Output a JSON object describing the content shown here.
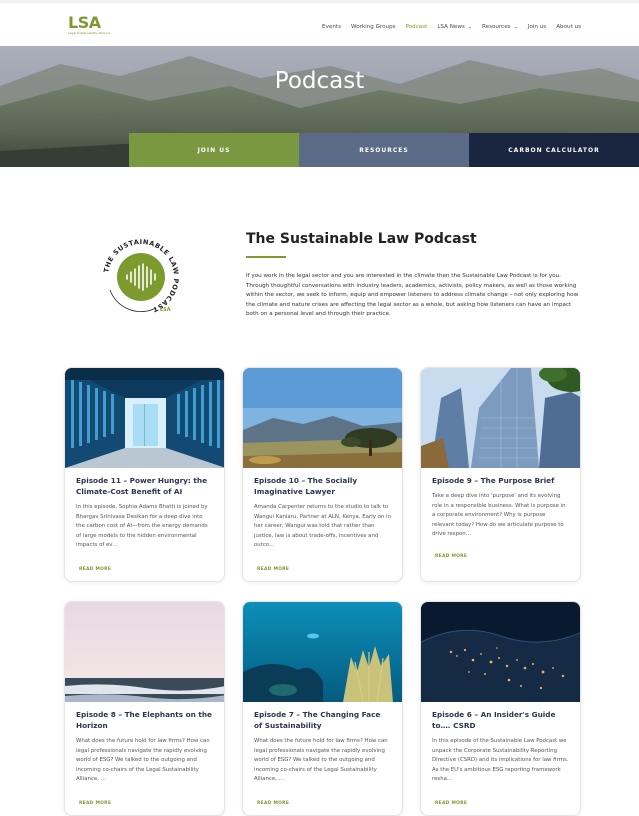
{
  "header": {
    "logo_text": "LSA",
    "logo_subtext": "Legal Sustainability Alliance",
    "nav": [
      {
        "label": "Events",
        "has_dropdown": false,
        "active": false
      },
      {
        "label": "Working Groups",
        "has_dropdown": false,
        "active": false
      },
      {
        "label": "Podcast",
        "has_dropdown": false,
        "active": true
      },
      {
        "label": "LSA News",
        "has_dropdown": true,
        "active": false
      },
      {
        "label": "Resources",
        "has_dropdown": true,
        "active": false
      },
      {
        "label": "Join us",
        "has_dropdown": false,
        "active": false
      },
      {
        "label": "About us",
        "has_dropdown": false,
        "active": false
      }
    ]
  },
  "hero": {
    "title": "Podcast"
  },
  "tabs": [
    {
      "label": "JOIN US",
      "color": "#7a9840"
    },
    {
      "label": "RESOURCES",
      "color": "#5b6a86"
    },
    {
      "label": "CARBON CALCULATOR",
      "color": "#1a2540"
    }
  ],
  "intro": {
    "badge_text": "THE SUSTAINABLE LAW PODCAST",
    "badge_logo": "LSA",
    "title": "The Sustainable Law Podcast",
    "body": "If you work in the legal sector and you are interested in the climate then the Sustainable Law Podcast is for you. Through thoughtful conversations with industry leaders, academics, activists, policy makers, as well as those working within the sector, we seek to inform, equip and empower listeners to address climate change – not only exploring how the climate and nature crises are affecting the legal sector as a whole, but asking how listeners can have an impact both on a personal level and through their practice."
  },
  "episodes": [
    {
      "title": "Episode 11 – Power Hungry: the Climate-Cost Benefit of AI",
      "excerpt": "In this episode, Sophia Adams Bhatti is joined by Bhargav Srinivasa Desikan for a deep dive into the carbon cost of AI—from the energy demands of large models to the hidden environmental impacts of ev…",
      "more": "READ MORE",
      "image": "server-room"
    },
    {
      "title": "Episode 10 – The Socially Imaginative Lawyer",
      "excerpt": "Amanda Carpenter returns to the studio to talk to Wangui Kaniaru, Partner at ALN, Kenya. Early on in her career, Wangui was told that rather than justice, law is about trade-offs, incentives and outco…",
      "more": "READ MORE",
      "image": "savanna-landscape"
    },
    {
      "title": "Episode 9 – The Purpose Brief",
      "excerpt": "Take a deep dive into 'purpose' and its evolving role in a responsible business. What is purpose in a corporate environment? Why is purpose relevant today? How do we articulate purpose to drive respon…",
      "more": "READ MORE",
      "image": "office-towers"
    },
    {
      "title": "Episode 8 – The Elephants on the Horizon",
      "excerpt": "What does the future hold for law firms? How can legal professionals navigate the rapidly evolving world of ESG? We talked to the outgoing and incoming co-chairs of the Legal Sustainability Alliance, …",
      "more": "READ MORE",
      "image": "ocean-horizon"
    },
    {
      "title": "Episode 7 – The Changing Face of Sustainability",
      "excerpt": "What does the future hold for law firms? How can legal professionals navigate the rapidly evolving world of ESG? We talked to the outgoing and incoming co-chairs of the Legal Sustainability Alliance, …",
      "more": "READ MORE",
      "image": "coral-reef"
    },
    {
      "title": "Episode 6 – An Insider's Guide to…. CSRD",
      "excerpt": "In this episode of the Sustainable Law Podcast we unpack the Corporate Sustainability Reporting Directive (CSRD) and its implications for law firms. As the EU's ambitious ESG reporting framework resha…",
      "more": "READ MORE",
      "image": "earth-night-lights"
    }
  ]
}
